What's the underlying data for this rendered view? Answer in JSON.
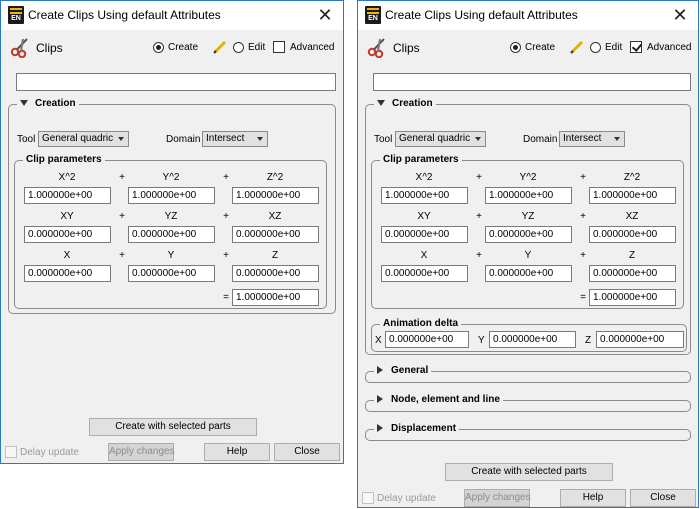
{
  "windows": [
    {
      "title": "Create Clips Using default Attributes",
      "app_badge": "EN",
      "header": {
        "label": "Clips",
        "create_label": "Create",
        "edit_label": "Edit",
        "advanced_label": "Advanced",
        "mode": "create",
        "advanced_checked": false
      },
      "name_value": "",
      "creation": {
        "title": "Creation",
        "tool_label": "Tool",
        "tool_value": "General quadric",
        "domain_label": "Domain",
        "domain_value": "Intersect",
        "clip_title": "Clip parameters",
        "rows": [
          {
            "labels": [
              "X^2",
              "Y^2",
              "Z^2"
            ],
            "values": [
              "1.000000e+00",
              "1.000000e+00",
              "1.000000e+00"
            ]
          },
          {
            "labels": [
              "XY",
              "YZ",
              "XZ"
            ],
            "values": [
              "0.000000e+00",
              "0.000000e+00",
              "0.000000e+00"
            ]
          },
          {
            "labels": [
              "X",
              "Y",
              "Z"
            ],
            "values": [
              "0.000000e+00",
              "0.000000e+00",
              "0.000000e+00"
            ]
          }
        ],
        "plus": "+",
        "equals": "=",
        "constant": "1.000000e+00"
      },
      "footer": {
        "create_btn": "Create with selected parts",
        "delay_label": "Delay update",
        "apply_btn": "Apply changes",
        "help_btn": "Help",
        "close_btn": "Close"
      }
    },
    {
      "title": "Create Clips Using default Attributes",
      "app_badge": "EN",
      "header": {
        "label": "Clips",
        "create_label": "Create",
        "edit_label": "Edit",
        "advanced_label": "Advanced",
        "mode": "create",
        "advanced_checked": true
      },
      "name_value": "",
      "creation": {
        "title": "Creation",
        "tool_label": "Tool",
        "tool_value": "General quadric",
        "domain_label": "Domain",
        "domain_value": "Intersect",
        "clip_title": "Clip parameters",
        "rows": [
          {
            "labels": [
              "X^2",
              "Y^2",
              "Z^2"
            ],
            "values": [
              "1.000000e+00",
              "1.000000e+00",
              "1.000000e+00"
            ]
          },
          {
            "labels": [
              "XY",
              "YZ",
              "XZ"
            ],
            "values": [
              "0.000000e+00",
              "0.000000e+00",
              "0.000000e+00"
            ]
          },
          {
            "labels": [
              "X",
              "Y",
              "Z"
            ],
            "values": [
              "0.000000e+00",
              "0.000000e+00",
              "0.000000e+00"
            ]
          }
        ],
        "plus": "+",
        "equals": "=",
        "constant": "1.000000e+00",
        "animation": {
          "title": "Animation delta",
          "x_label": "X",
          "x_value": "0.000000e+00",
          "y_label": "Y",
          "y_value": "0.000000e+00",
          "z_label": "Z",
          "z_value": "0.000000e+00"
        }
      },
      "collapsed_sections": [
        "General",
        "Node, element and line",
        "Displacement"
      ],
      "footer": {
        "create_btn": "Create with selected parts",
        "delay_label": "Delay update",
        "apply_btn": "Apply changes",
        "help_btn": "Help",
        "close_btn": "Close"
      }
    }
  ]
}
